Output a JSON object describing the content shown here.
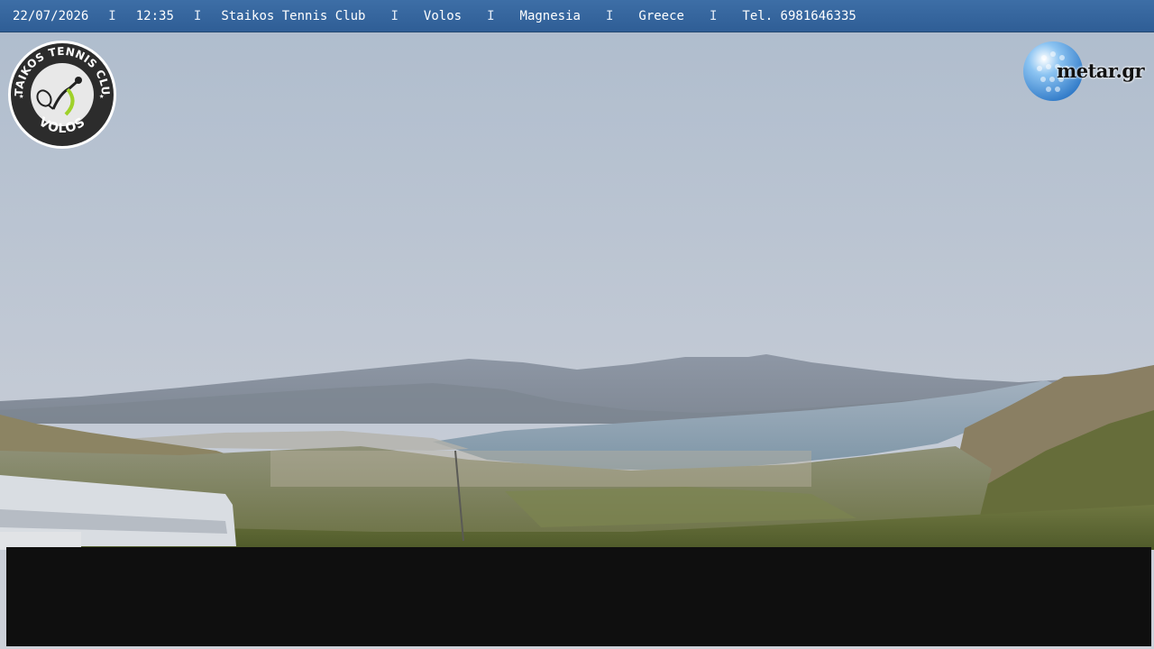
{
  "header": {
    "date": "22/07/2026",
    "time": "12:35",
    "club": "Staikos Tennis Club",
    "city": "Volos",
    "region": "Magnesia",
    "country": "Greece",
    "phone": "Tel. 6981646335",
    "separator": "I"
  },
  "logo_left": {
    "top_text": "STAIKOS TENNIS CLUB",
    "bottom_text": "VOLOS"
  },
  "logo_right": {
    "text": "metar.gr"
  },
  "colors": {
    "header_bar": "#3366a0",
    "sky": "#bcc6d3",
    "sea": "#8ea3b3",
    "panel": "#0f0f0f"
  }
}
